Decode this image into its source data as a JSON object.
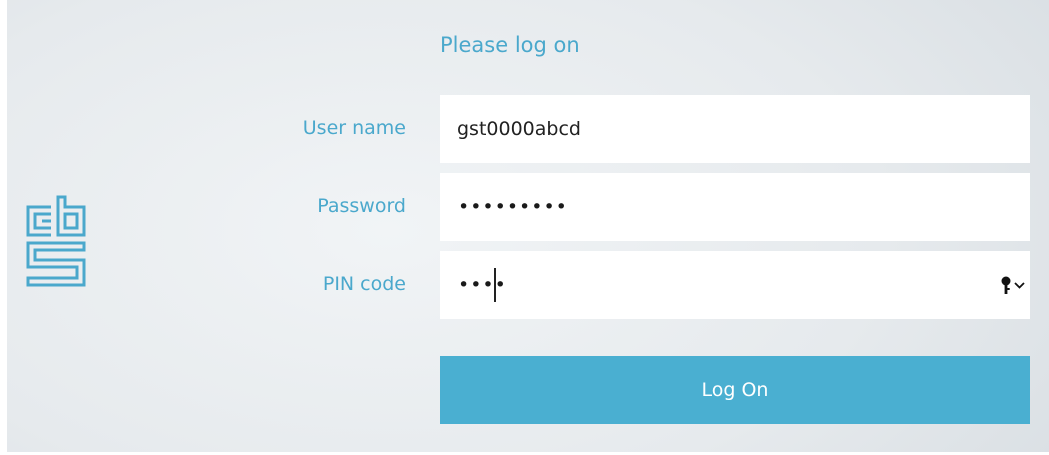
{
  "form": {
    "title": "Please log on",
    "username": {
      "label": "User name",
      "value": "gst0000abcd"
    },
    "password": {
      "label": "Password",
      "masked_value": "•••••••••"
    },
    "pin": {
      "label": "PIN code",
      "masked_value": "••••",
      "menu_icon": "key-icon"
    },
    "submit_label": "Log On"
  },
  "logo": {
    "icon": "cbs-logo",
    "color": "#4aa8cc"
  },
  "colors": {
    "accent": "#4aa8cc",
    "button": "#4aafd1",
    "field_background": "#ffffff"
  }
}
